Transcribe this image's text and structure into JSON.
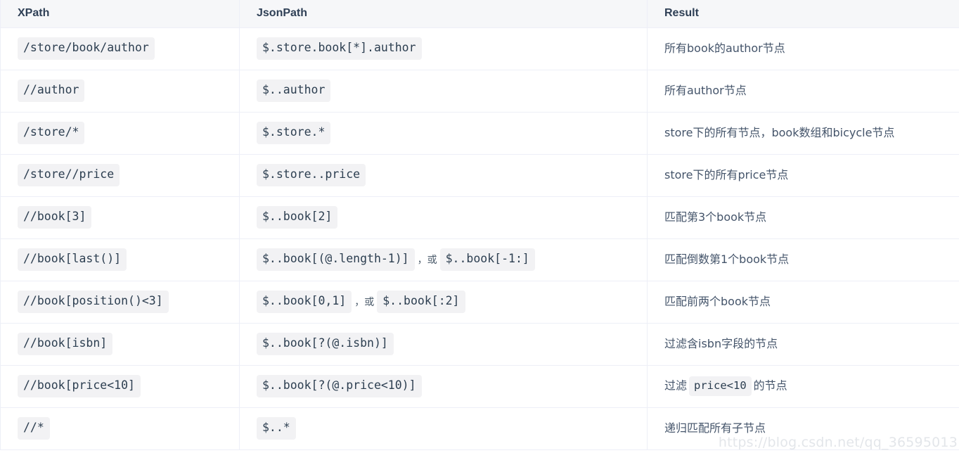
{
  "table": {
    "headers": [
      {
        "label": "XPath"
      },
      {
        "label": "JsonPath"
      },
      {
        "label": "Result"
      }
    ],
    "or_separator": "，或",
    "rows": [
      {
        "xpath": "/store/book/author",
        "jsonpath": "$.store.book[*].author",
        "jsonpath_alt": "",
        "result_before": "所有book的author节点",
        "result_code": "",
        "result_after": ""
      },
      {
        "xpath": "//author",
        "jsonpath": "$..author",
        "jsonpath_alt": "",
        "result_before": "所有author节点",
        "result_code": "",
        "result_after": ""
      },
      {
        "xpath": "/store/*",
        "jsonpath": "$.store.*",
        "jsonpath_alt": "",
        "result_before": "store下的所有节点，book数组和bicycle节点",
        "result_code": "",
        "result_after": ""
      },
      {
        "xpath": "/store//price",
        "jsonpath": "$.store..price",
        "jsonpath_alt": "",
        "result_before": "store下的所有price节点",
        "result_code": "",
        "result_after": ""
      },
      {
        "xpath": "//book[3]",
        "jsonpath": "$..book[2]",
        "jsonpath_alt": "",
        "result_before": "匹配第3个book节点",
        "result_code": "",
        "result_after": ""
      },
      {
        "xpath": "//book[last()]",
        "jsonpath": "$..book[(@.length-1)]",
        "jsonpath_alt": "$..book[-1:]",
        "result_before": "匹配倒数第1个book节点",
        "result_code": "",
        "result_after": ""
      },
      {
        "xpath": "//book[position()<3]",
        "jsonpath": "$..book[0,1]",
        "jsonpath_alt": "$..book[:2]",
        "result_before": "匹配前两个book节点",
        "result_code": "",
        "result_after": ""
      },
      {
        "xpath": "//book[isbn]",
        "jsonpath": "$..book[?(@.isbn)]",
        "jsonpath_alt": "",
        "result_before": "过滤含isbn字段的节点",
        "result_code": "",
        "result_after": ""
      },
      {
        "xpath": "//book[price<10]",
        "jsonpath": "$..book[?(@.price<10)]",
        "jsonpath_alt": "",
        "result_before": "过滤",
        "result_code": "price<10",
        "result_after": "的节点"
      },
      {
        "xpath": "//*",
        "jsonpath": "$..*",
        "jsonpath_alt": "",
        "result_before": "递归匹配所有子节点",
        "result_code": "",
        "result_after": ""
      }
    ]
  },
  "watermark": {
    "text": "https://blog.csdn.net/qq_36595013"
  }
}
